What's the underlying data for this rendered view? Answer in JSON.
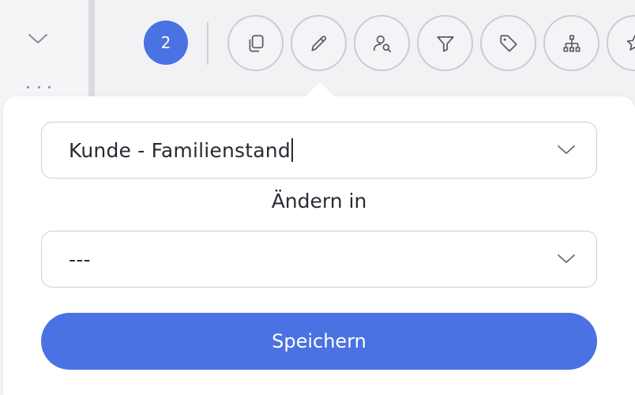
{
  "toolbar": {
    "selection_count": "2",
    "tools": [
      {
        "icon": "copy-icon"
      },
      {
        "icon": "pencil-icon"
      },
      {
        "icon": "user-search-icon"
      },
      {
        "icon": "filter-icon"
      },
      {
        "icon": "tag-icon"
      },
      {
        "icon": "hierarchy-icon"
      },
      {
        "icon": "star-icon"
      }
    ]
  },
  "sidebar": {
    "collapse_icon": "chevron-down-icon",
    "more_icon": "more-dots-icon"
  },
  "popover": {
    "field_select": {
      "value": "Kunde - Familienstand"
    },
    "change_label": "Ändern in",
    "value_select": {
      "value": "---"
    },
    "save_label": "Speichern"
  },
  "colors": {
    "accent": "#4a72e2",
    "border": "#cfcfd4",
    "text": "#2a2a33"
  }
}
